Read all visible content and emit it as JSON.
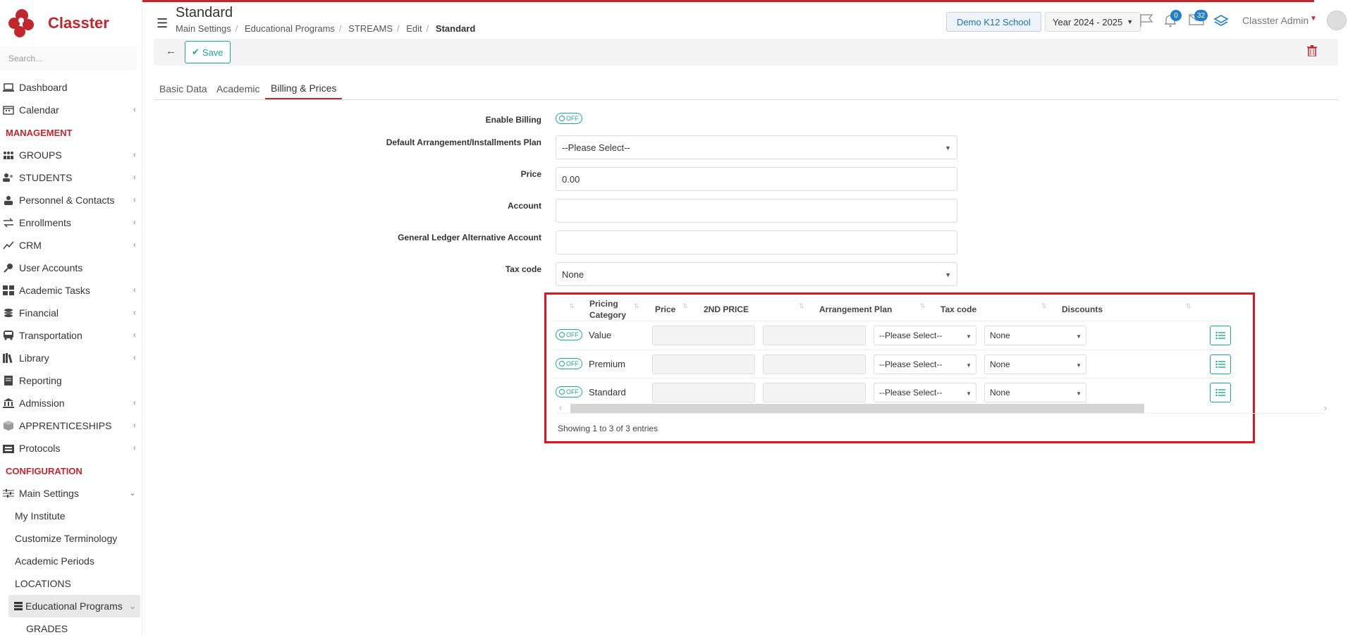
{
  "app": {
    "logo_text": "Classter"
  },
  "sidebar": {
    "search_placeholder": "Search...",
    "top_items": [
      {
        "label": "Dashboard"
      },
      {
        "label": "Calendar"
      }
    ],
    "management_title": "MANAGEMENT",
    "management_items": [
      {
        "label": "GROUPS"
      },
      {
        "label": "STUDENTS"
      },
      {
        "label": "Personnel & Contacts"
      },
      {
        "label": "Enrollments"
      },
      {
        "label": "CRM"
      },
      {
        "label": "User Accounts"
      },
      {
        "label": "Academic Tasks"
      },
      {
        "label": "Financial"
      },
      {
        "label": "Transportation"
      },
      {
        "label": "Library"
      },
      {
        "label": "Reporting"
      },
      {
        "label": "Admission"
      },
      {
        "label": "APPRENTICESHIPS"
      },
      {
        "label": "Protocols"
      }
    ],
    "configuration_title": "CONFIGURATION",
    "main_settings": "Main Settings",
    "sub_items": [
      {
        "label": "My Institute"
      },
      {
        "label": "Customize Terminology"
      },
      {
        "label": "Academic Periods"
      },
      {
        "label": "LOCATIONS"
      }
    ],
    "active_item": "Educational Programs",
    "deep_item": "GRADES"
  },
  "header": {
    "title": "Standard",
    "breadcrumb": [
      "Main Settings",
      "Educational Programs",
      "STREAMS",
      "Edit",
      "Standard"
    ],
    "school": "Demo K12 School",
    "year": "Year 2024 - 2025",
    "notifications_count": "0",
    "messages_count": "32",
    "user": "Classter Admin"
  },
  "toolbar": {
    "save_label": "Save"
  },
  "tabs": [
    {
      "label": "Basic Data"
    },
    {
      "label": "Academic"
    },
    {
      "label": "Billing & Prices"
    }
  ],
  "form": {
    "enable_billing_label": "Enable Billing",
    "toggle_off": "OFF",
    "arrangement_label": "Default Arrangement/Installments Plan",
    "arrangement_value": "--Please Select--",
    "price_label": "Price",
    "price_value": "0.00",
    "account_label": "Account",
    "account_value": "",
    "gl_label": "General Ledger Alternative Account",
    "gl_value": "",
    "tax_label": "Tax code",
    "tax_value": "None"
  },
  "table": {
    "headers": {
      "pricing_category_1": "Pricing",
      "pricing_category_2": "Category",
      "price": "Price",
      "second_price": "2ND PRICE",
      "arrangement_plan": "Arrangement Plan",
      "tax_code": "Tax code",
      "discounts": "Discounts"
    },
    "rows": [
      {
        "toggle": "OFF",
        "name": "Value",
        "arrangement": "--Please Select--",
        "tax": "None"
      },
      {
        "toggle": "OFF",
        "name": "Premium",
        "arrangement": "--Please Select--",
        "tax": "None"
      },
      {
        "toggle": "OFF",
        "name": "Standard",
        "arrangement": "--Please Select--",
        "tax": "None"
      }
    ],
    "footer": "Showing 1 to 3 of 3 entries"
  },
  "colors": {
    "brand": "#c1272d",
    "accent": "#1fa88e",
    "highlight": "#e0141e"
  }
}
